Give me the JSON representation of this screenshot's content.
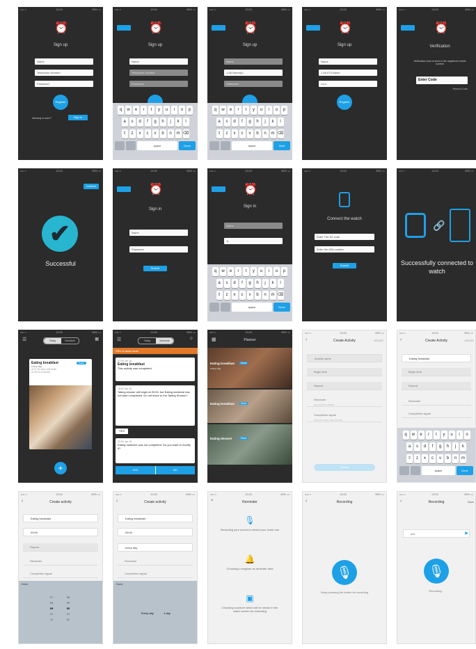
{
  "colors": {
    "accent": "#1ea0e6",
    "dark_bg": "#2b2b2b",
    "light_bg": "#f1f1f1",
    "orange": "#e07a2a"
  },
  "common": {
    "back": "Back",
    "status_time": "13:00",
    "status_carrier": "•••• ≈",
    "status_battery": "98% ▭"
  },
  "row1": {
    "s1": {
      "title": "Sign up",
      "name": "Name",
      "phone": "Telephone Number",
      "password": "Password",
      "register": "Register",
      "already": "Already a user?",
      "signin": "Sign in"
    },
    "s2": {
      "title": "Sign up",
      "name": "Name",
      "phone": "Telephone Number",
      "password": "Password",
      "space": "space",
      "done": "Done"
    },
    "s3": {
      "title": "Sign up",
      "name": "Name",
      "phone": "1-66 Name(h)",
      "password": "Password",
      "space": "space",
      "next": "Next"
    },
    "s4": {
      "title": "Sign up",
      "name": "Name",
      "phone": "1-66 673 Name",
      "password": "••••••",
      "register": "Register"
    },
    "s5": {
      "title": "Verification",
      "desc": "Verification code is send to the registered mobile number",
      "code": "Enter Code",
      "resend": "Resend Code"
    }
  },
  "row2": {
    "s1": {
      "skip": "Continue",
      "status": "Successful"
    },
    "s2": {
      "title": "Sign in",
      "name": "Name",
      "password": "Password",
      "submit": "Submit"
    },
    "s3": {
      "title": "Sign in",
      "name": "Name",
      "password": "1|",
      "space": "space",
      "done": "Done"
    },
    "s4": {
      "title": "Connect the watch",
      "field1": "Enter The S/I code",
      "field2": "Enter the IDN number",
      "submit": "Submit"
    },
    "s5": {
      "status": "Successfully connected to watch"
    }
  },
  "row3": {
    "s1": {
      "tab1": "Today",
      "tab2": "Schedule",
      "card_title": "Eating breakfast",
      "card_badge": "Done",
      "card_sub": "every day",
      "card_meta1": "at 07:00 wait until finish",
      "card_meta2": "at 08:00 reminder"
    },
    "s2": {
      "tab1": "Today",
      "tab2": "Schedule",
      "banner": "25% of tasks done",
      "n1_time": "07:00 Jan 16",
      "n1_title": "Eating breakfast",
      "n1_text": "This activity was completed.",
      "n2_time": "18:00 Jan 16",
      "n2_text": "Taking shower will begin at 20:00, but Eating medicine has not been completed. Do not leave to the Taking Shower?",
      "yes": "YES",
      "n3_time": "20:00 Jan 16",
      "n3_text": "Eating medicine was not completed. Do you want to modify it?",
      "yes2": "YES",
      "no2": "NO"
    },
    "s3": {
      "title": "Planner",
      "e1_title": "Eating breakfast",
      "e1_badge": "Done",
      "e1_sub": "every day",
      "e2_title": "Eating breakfast",
      "e2_badge": "Done",
      "e3_title": "Eating dessert",
      "e3_badge": "Done"
    },
    "s4": {
      "title": "Create Activity",
      "action": "UPDATE",
      "f1": "Activity name",
      "f2": "Begin time",
      "f3": "Repeat",
      "f4": "Reminder",
      "f4_sub": "Use sound or vibration",
      "f5": "Completion signal",
      "f5_sub": "Press the button when finished",
      "submit": "Submit"
    },
    "s5": {
      "title": "Create Activity",
      "action": "UPDATE",
      "f1": "Eating breakfast",
      "f2": "Begin time",
      "f3": "Repeat",
      "f4": "Reminder",
      "f5": "Completion signal",
      "space": "space",
      "done": "Done"
    }
  },
  "row4": {
    "s1": {
      "title": "Create activity",
      "f1": "Eating breakfast",
      "f2": "09:00",
      "f3": "Repeat",
      "f4": "Reminder",
      "f5": "Completion signal",
      "done": "Done",
      "p1": [
        "07",
        "08",
        "09",
        "10",
        "11"
      ],
      "p2": [
        "58",
        "59",
        "00",
        "01",
        "02"
      ]
    },
    "s2": {
      "title": "Create activity",
      "f1": "Eating breakfast",
      "f2": "09:00",
      "f3": "every day",
      "f4": "Reminder",
      "f5": "Completion signal",
      "done": "Done",
      "p1": [
        "Every day",
        "1 day"
      ]
    },
    "s3": {
      "title": "Reminder",
      "t1": "Recording your sound to remind your loved one",
      "t2": "Choosing a ringtone as reminder alert",
      "t3": "Choosing a picture which will be shown in the watch screen for reminding"
    },
    "s4": {
      "title": "Recording",
      "hint": "Keep pressing the button for recording"
    },
    "s5": {
      "title": "Recording",
      "save": "Save",
      "field": "sd1",
      "hint": "Recording..."
    }
  }
}
